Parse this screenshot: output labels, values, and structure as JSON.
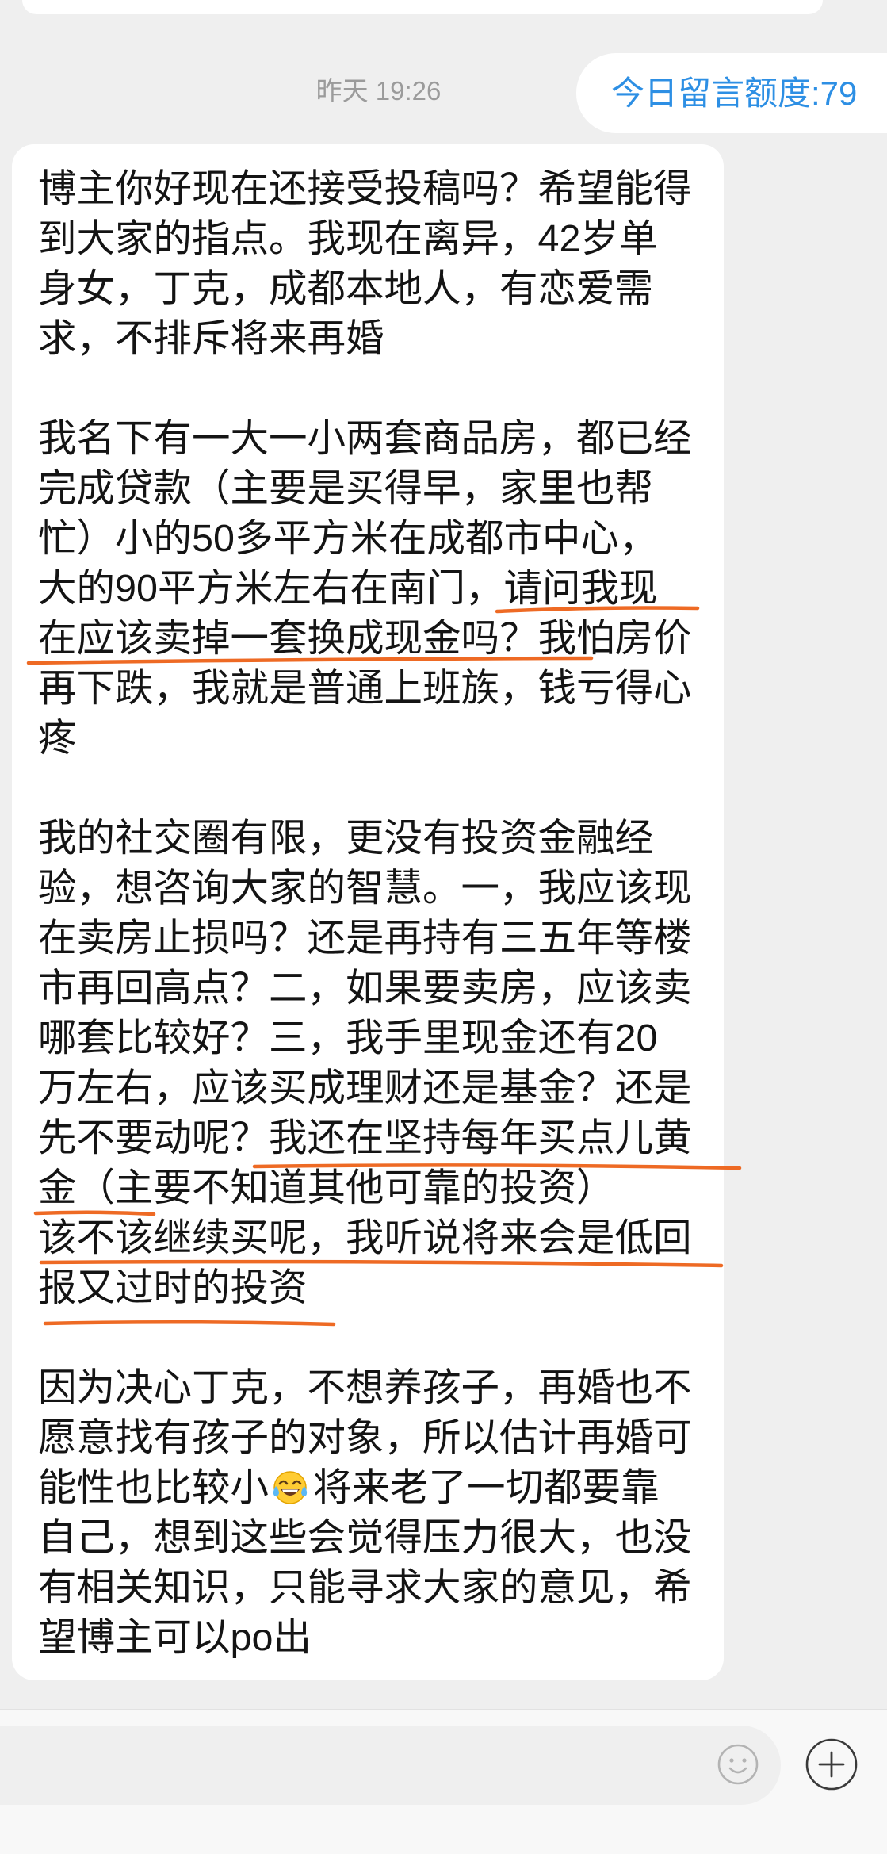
{
  "colors": {
    "background": "#efefef",
    "quota_text": "#2d8fe4",
    "annotation": "#ee6a24"
  },
  "timestamp": "昨天 19:26",
  "quota_bubble": {
    "label": "今日留言额度:79"
  },
  "message": {
    "paragraphs": [
      {
        "lines": [
          "博主你好现在还接受投稿吗？希望能得",
          "到大家的指点。我现在离异，42岁单",
          "身女，丁克，成都本地人，有恋爱需",
          "求，不排斥将来再婚"
        ]
      },
      {
        "lines": [
          "我名下有一大一小两套商品房，都已经",
          "完成贷款（主要是买得早，家里也帮",
          "忙）小的50多平方米在成都市中心，",
          "大的90平方米左右在南门，请问我现",
          "在应该卖掉一套换成现金吗？我怕房价",
          "再下跌，我就是普通上班族，钱亏得心",
          "疼"
        ]
      },
      {
        "lines": [
          "我的社交圈有限，更没有投资金融经",
          "验，想咨询大家的智慧。一，我应该现",
          "在卖房止损吗？还是再持有三五年等楼",
          "市再回高点？二，如果要卖房，应该卖",
          "哪套比较好？三，我手里现金还有20",
          "万左右，应该买成理财还是基金？还是",
          "先不要动呢？我还在坚持每年买点儿黄",
          "金（主要不知道其他可靠的投资）",
          "该不该继续买呢，我听说将来会是低回",
          "报又过时的投资"
        ]
      },
      {
        "lines": [
          "因为决心丁克，不想养孩子，再婚也不",
          "愿意找有孩子的对象，所以估计再婚可",
          {
            "before": "能性也比较小",
            "emoji_icon": "face-with-tears-of-joy-icon",
            "after": "将来老了一切都要靠"
          },
          "自己，想到这些会觉得压力很大，也没",
          "有相关知识，只能寻求大家的意见，希",
          "望博主可以po出"
        ]
      }
    ]
  },
  "input_bar": {
    "emoji_button_icon": "smiley-face-icon",
    "add_button_icon": "plus-circle-icon"
  }
}
